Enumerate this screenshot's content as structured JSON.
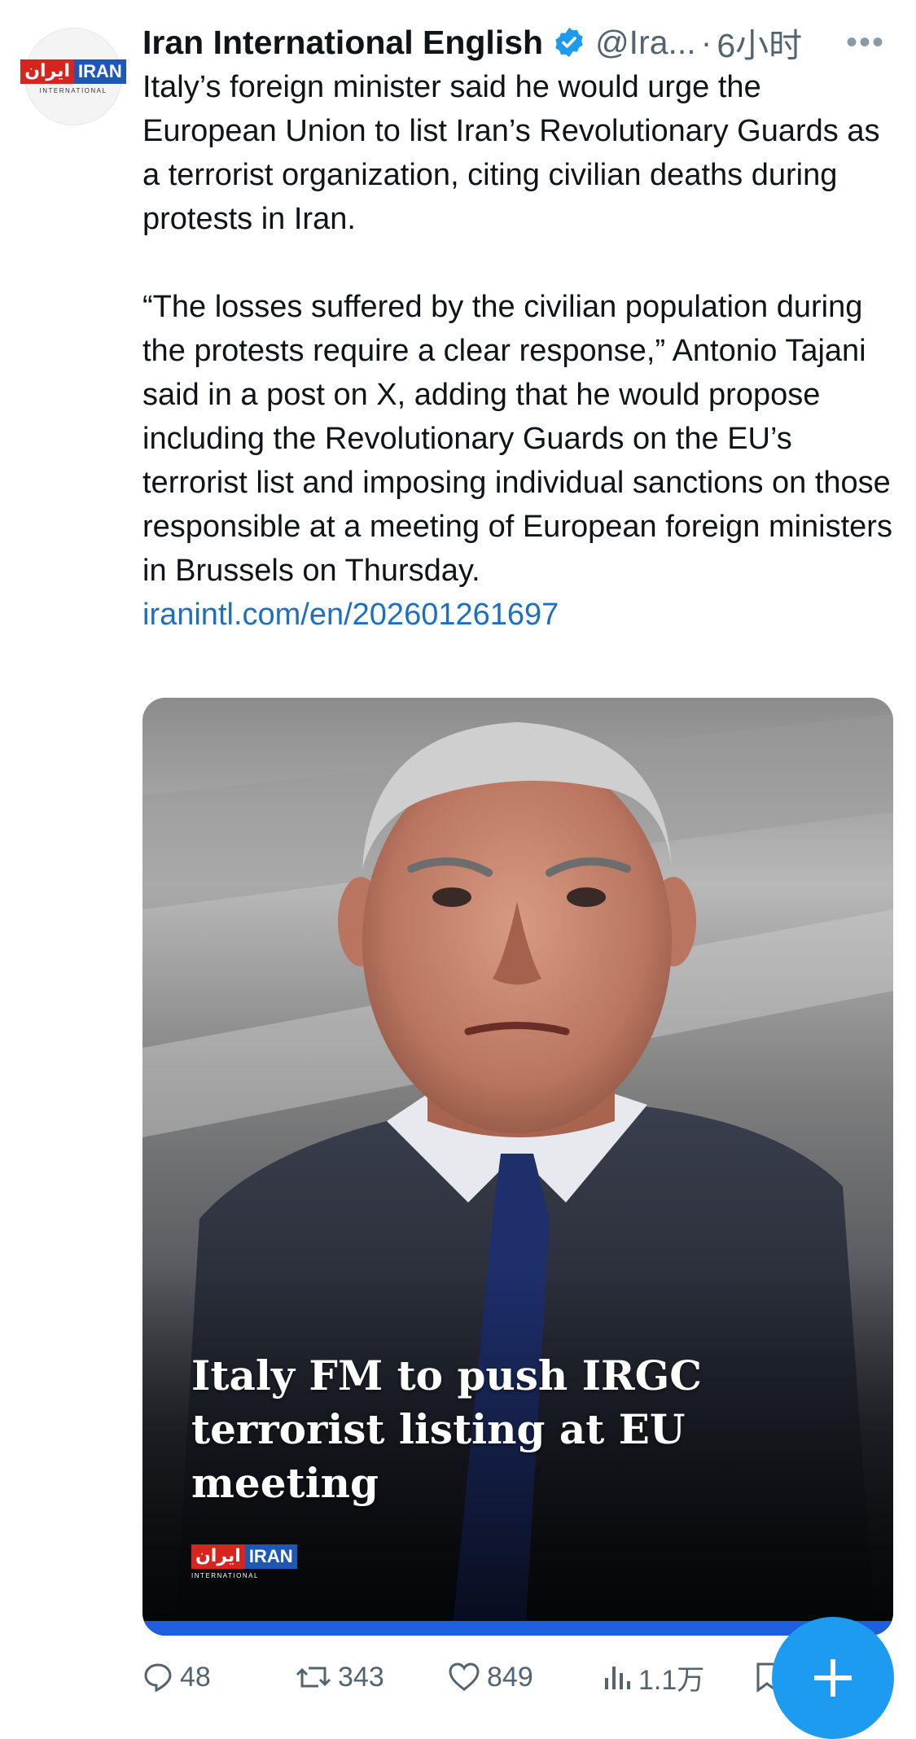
{
  "tweet": {
    "author_name": "Iran International English",
    "handle": "@Ira...",
    "separator": "·",
    "time": "6小时",
    "more_icon": "more-horizontal-icon",
    "body_paragraph_1": "Italy’s foreign minister said he would urge the European Union to list Iran’s Revolutionary Guards as a terrorist organization, citing civilian deaths during protests in Iran.",
    "body_paragraph_2": "“The losses suffered by the civilian population during the protests require a clear response,” Antonio Tajani said in a post on X, adding that he would propose including the Revolutionary Guards on the EU’s terrorist list and imposing individual sanctions on those responsible at a meeting of European foreign ministers in Brussels on Thursday.",
    "link_text": "iranintl.com/en/202601261697"
  },
  "avatar_logo": {
    "fa": "ایران",
    "en": "IRAN",
    "sub": "INTERNATIONAL"
  },
  "media": {
    "headline": "Italy FM to push IRGC terrorist listing at EU meeting",
    "logo_fa": "ایران",
    "logo_en": "IRAN",
    "logo_sub": "INTERNATIONAL"
  },
  "actions": {
    "replies": "48",
    "retweets": "343",
    "likes": "849",
    "views": "1.1万"
  },
  "colors": {
    "accent": "#1d9bf0",
    "link": "#1d6fc2",
    "muted": "#536471"
  }
}
